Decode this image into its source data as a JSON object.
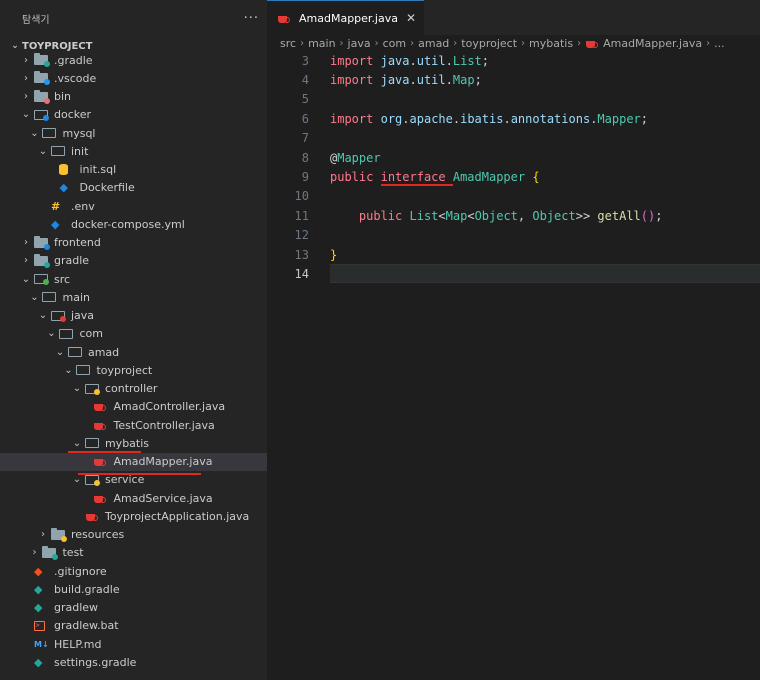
{
  "sidebar": {
    "title": "탐색기",
    "more_label": "···",
    "root_label": "TOYPROJECT",
    "items": [
      {
        "label": ".gradle",
        "icon": "folder-gradle-icon",
        "expanded": false
      },
      {
        "label": ".vscode",
        "icon": "folder-vscode-icon",
        "expanded": false
      },
      {
        "label": "bin",
        "icon": "folder-bin-icon",
        "expanded": false
      },
      {
        "label": "docker",
        "icon": "folder-docker-icon",
        "expanded": true
      },
      {
        "label": "mysql",
        "icon": "folder-icon",
        "expanded": true
      },
      {
        "label": "init",
        "icon": "folder-icon",
        "expanded": true
      },
      {
        "label": "init.sql",
        "icon": "database-icon"
      },
      {
        "label": "Dockerfile",
        "icon": "docker-icon"
      },
      {
        "label": ".env",
        "icon": "env-icon"
      },
      {
        "label": "docker-compose.yml",
        "icon": "docker-icon"
      },
      {
        "label": "frontend",
        "icon": "folder-frontend-icon",
        "expanded": false
      },
      {
        "label": "gradle",
        "icon": "folder-gradle-icon",
        "expanded": false
      },
      {
        "label": "src",
        "icon": "folder-src-icon",
        "expanded": true
      },
      {
        "label": "main",
        "icon": "folder-icon",
        "expanded": true
      },
      {
        "label": "java",
        "icon": "folder-java-icon",
        "expanded": true
      },
      {
        "label": "com",
        "icon": "folder-icon",
        "expanded": true
      },
      {
        "label": "amad",
        "icon": "folder-icon",
        "expanded": true
      },
      {
        "label": "toyproject",
        "icon": "folder-icon",
        "expanded": true
      },
      {
        "label": "controller",
        "icon": "folder-controller-icon",
        "expanded": true
      },
      {
        "label": "AmadController.java",
        "icon": "java-icon"
      },
      {
        "label": "TestController.java",
        "icon": "java-icon"
      },
      {
        "label": "mybatis",
        "icon": "folder-icon",
        "expanded": true
      },
      {
        "label": "AmadMapper.java",
        "icon": "java-icon",
        "selected": true
      },
      {
        "label": "service",
        "icon": "folder-service-icon",
        "expanded": true
      },
      {
        "label": "AmadService.java",
        "icon": "java-icon"
      },
      {
        "label": "ToyprojectApplication.java",
        "icon": "java-icon"
      },
      {
        "label": "resources",
        "icon": "folder-resources-icon",
        "expanded": false
      },
      {
        "label": "test",
        "icon": "folder-test-icon",
        "expanded": false
      },
      {
        "label": ".gitignore",
        "icon": "git-icon"
      },
      {
        "label": "build.gradle",
        "icon": "gradle-icon"
      },
      {
        "label": "gradlew",
        "icon": "gradle-icon"
      },
      {
        "label": "gradlew.bat",
        "icon": "terminal-icon"
      },
      {
        "label": "HELP.md",
        "icon": "markdown-icon"
      },
      {
        "label": "settings.gradle",
        "icon": "gradle-icon"
      }
    ]
  },
  "editor": {
    "tab": {
      "label": "AmadMapper.java",
      "close": "✕"
    },
    "breadcrumb": [
      "src",
      "main",
      "java",
      "com",
      "amad",
      "toyproject",
      "mybatis",
      "AmadMapper.java",
      "..."
    ],
    "lines": [
      {
        "num": "3",
        "text": "import java.util.List;"
      },
      {
        "num": "4",
        "text": "import java.util.Map;"
      },
      {
        "num": "5",
        "text": ""
      },
      {
        "num": "6",
        "text": "import org.apache.ibatis.annotations.Mapper;"
      },
      {
        "num": "7",
        "text": ""
      },
      {
        "num": "8",
        "text": "@Mapper"
      },
      {
        "num": "9",
        "text": "public interface AmadMapper {"
      },
      {
        "num": "10",
        "text": ""
      },
      {
        "num": "11",
        "text": "    public List<Map<Object, Object>> getAll();"
      },
      {
        "num": "12",
        "text": ""
      },
      {
        "num": "13",
        "text": "}"
      },
      {
        "num": "14",
        "text": ""
      }
    ],
    "current_line": "14"
  },
  "colors": {
    "accent": "#2f7ab8",
    "highlight": "#e0281f",
    "java": "#e53935"
  }
}
